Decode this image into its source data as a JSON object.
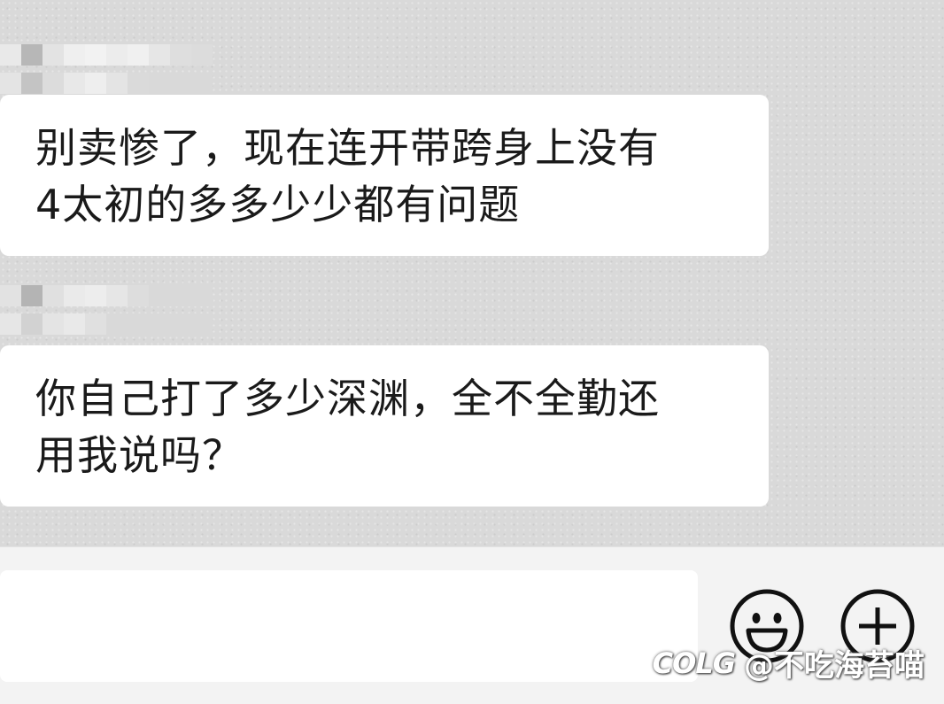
{
  "messages": [
    {
      "text": "别卖惨了，现在连开带跨身上没有\n4太初的多多少少都有问题"
    },
    {
      "text": "你自己打了多少深渊，全不全勤还\n用我说吗？"
    }
  ],
  "input": {
    "placeholder": ""
  },
  "icons": {
    "emoji": "smiley-face-icon",
    "plus": "plus-circle-icon"
  },
  "watermark": {
    "logo": "COLG",
    "handle": "@不吃海苔喵"
  },
  "colors": {
    "chat_background": "#d9d9d9",
    "bubble": "#ffffff",
    "input_bar": "#f3f3f3",
    "text": "#1a1a1a"
  }
}
